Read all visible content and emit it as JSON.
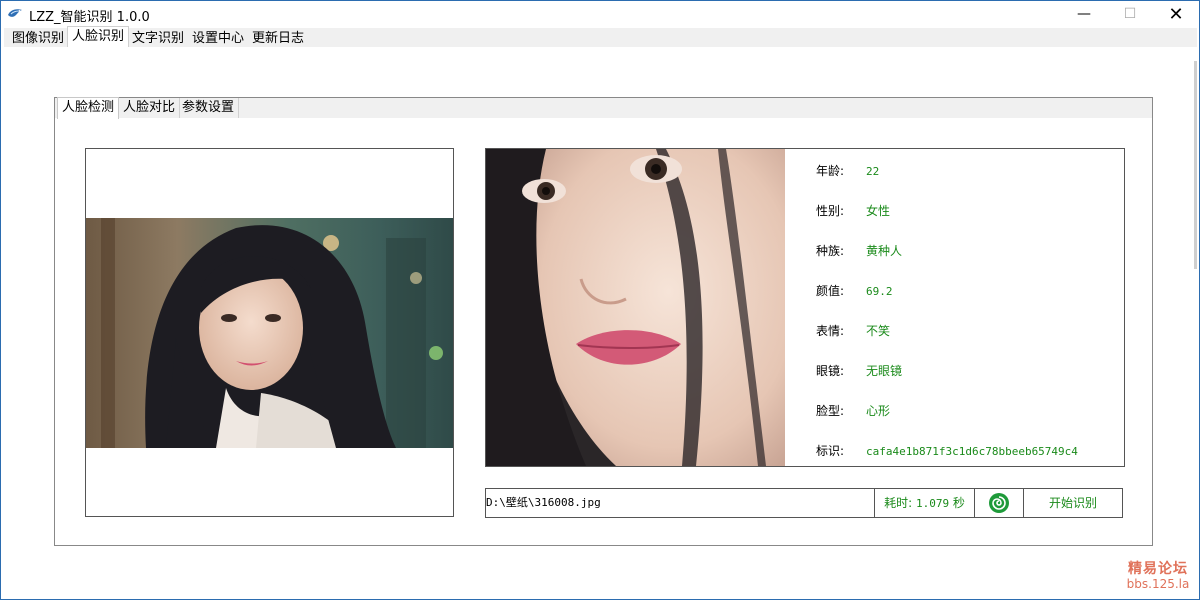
{
  "window": {
    "title": "LZZ_智能识别 1.0.0",
    "app_icon": "bird-logo-icon",
    "controls": {
      "minimize": "—",
      "maximize": "☐",
      "close": "✕"
    }
  },
  "menu_tabs": [
    {
      "label": "图像识别",
      "active": false
    },
    {
      "label": "人脸识别",
      "active": true
    },
    {
      "label": "文字识别",
      "active": false
    },
    {
      "label": "设置中心",
      "active": false
    },
    {
      "label": "更新日志",
      "active": false
    }
  ],
  "sub_tabs": [
    {
      "label": "人脸检测",
      "active": true
    },
    {
      "label": "人脸对比",
      "active": false
    },
    {
      "label": "参数设置",
      "active": false
    }
  ],
  "face_info": [
    {
      "label": "年龄:",
      "value": "22"
    },
    {
      "label": "性别:",
      "value": "女性"
    },
    {
      "label": "种族:",
      "value": "黄种人"
    },
    {
      "label": "颜值:",
      "value": "69.2"
    },
    {
      "label": "表情:",
      "value": "不笑"
    },
    {
      "label": "眼镜:",
      "value": "无眼镜"
    },
    {
      "label": "脸型:",
      "value": "心形"
    },
    {
      "label": "标识:",
      "value": "cafa4e1b871f3c1d6c78bbeeb65749c4"
    }
  ],
  "status": {
    "file_path": "D:\\壁纸\\316008.jpg",
    "time_label": "耗时:",
    "time_value": "1.079",
    "time_unit": "秒",
    "start_button": "开始识别"
  },
  "watermark": {
    "line1": "精易论坛",
    "line2": "bbs.125.la"
  },
  "colors": {
    "accent_green": "#1a8a1a",
    "watermark": "#e0725a",
    "window_border": "#2b6cb0"
  }
}
